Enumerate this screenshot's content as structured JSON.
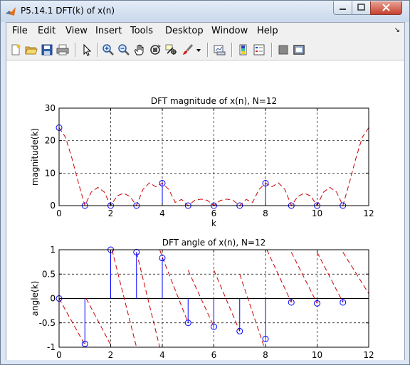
{
  "window": {
    "title": "P5.14.1 DFT(k) of x(n)"
  },
  "menubar": {
    "items": [
      "File",
      "Edit",
      "View",
      "Insert",
      "Tools",
      "Desktop",
      "Window",
      "Help"
    ]
  },
  "toolbar": {
    "icons": [
      "new-figure-icon",
      "open-file-icon",
      "save-icon",
      "print-icon",
      "edit-plot-arrow-icon",
      "zoom-in-icon",
      "zoom-out-icon",
      "pan-hand-icon",
      "rotate-3d-icon",
      "data-cursor-icon",
      "brush-icon",
      "brush-dropdown-icon",
      "link-plot-icon",
      "colorbar-icon",
      "legend-icon",
      "hide-plot-tools-icon",
      "show-plot-tools-icon"
    ]
  },
  "chart_data": [
    {
      "type": "stem",
      "title": "DFT magnitude of x(n), N=12",
      "xlabel": "k",
      "ylabel": "magnitude(k)",
      "xlim": [
        0,
        12
      ],
      "ylim": [
        0,
        30
      ],
      "xticks": [
        "0",
        "2",
        "4",
        "6",
        "8",
        "10",
        "12"
      ],
      "yticks": [
        "0",
        "10",
        "20",
        "30"
      ],
      "grid": true,
      "stem_x": [
        0,
        1,
        2,
        3,
        4,
        5,
        6,
        7,
        8,
        9,
        10,
        11
      ],
      "stem_y": [
        24,
        0,
        0,
        0,
        6.9,
        0,
        0,
        0,
        6.9,
        0,
        0,
        0
      ],
      "dashed_curve": {
        "color": "#cc0000",
        "x": [
          0,
          0.25,
          0.5,
          0.75,
          1,
          1.25,
          1.5,
          1.75,
          2,
          2.25,
          2.5,
          2.75,
          3,
          3.25,
          3.5,
          3.75,
          4,
          4.25,
          4.5,
          4.75,
          5,
          5.25,
          5.5,
          5.75,
          6,
          6.25,
          6.5,
          6.75,
          7,
          7.25,
          7.5,
          7.75,
          8,
          8.25,
          8.5,
          8.75,
          9,
          9.25,
          9.5,
          9.75,
          10,
          10.25,
          10.5,
          10.75,
          11,
          11.25,
          11.5,
          11.75,
          12
        ],
        "y": [
          24,
          21,
          14.5,
          7,
          0,
          4.2,
          5.6,
          4.2,
          0,
          3,
          3.8,
          2.8,
          0,
          5,
          7,
          5.8,
          6.9,
          5,
          1,
          1.9,
          0,
          1.6,
          2,
          1.6,
          0,
          1.6,
          2,
          1.6,
          0,
          1.9,
          1,
          5,
          6.9,
          5.8,
          7,
          5,
          0,
          2.8,
          3.8,
          3,
          0,
          4.2,
          5.6,
          4.2,
          0,
          7,
          14.5,
          21,
          24
        ]
      }
    },
    {
      "type": "stem",
      "title": "DFT angle of x(n), N=12",
      "xlabel": "k",
      "ylabel": "angle(k)",
      "xlim": [
        0,
        12
      ],
      "ylim": [
        -1,
        1
      ],
      "xticks": [
        "0",
        "2",
        "4",
        "6",
        "8",
        "10",
        "12"
      ],
      "yticks": [
        "-1",
        "-0.5",
        "0",
        "0.5",
        "1"
      ],
      "grid": true,
      "stem_x": [
        0,
        1,
        2,
        3,
        4,
        5,
        6,
        7,
        8,
        9,
        10,
        11
      ],
      "stem_y": [
        0,
        -0.93,
        1.0,
        0.95,
        0.83,
        -0.5,
        -0.58,
        -0.67,
        -0.83,
        -0.08,
        -0.1,
        -0.08
      ],
      "dashed_curve": {
        "color": "#cc0000",
        "segments": [
          {
            "x": [
              0,
              1.05
            ],
            "y": [
              0,
              -1
            ]
          },
          {
            "x": [
              1.05,
              2.05
            ],
            "y": [
              0,
              -1
            ]
          },
          {
            "x": [
              2.05,
              3.0
            ],
            "y": [
              1.0,
              -1
            ]
          },
          {
            "x": [
              3.0,
              3.9
            ],
            "y": [
              0.95,
              -1
            ]
          },
          {
            "x": [
              3.9,
              4.0
            ],
            "y": [
              1.0,
              0.85
            ]
          },
          {
            "x": [
              4.0,
              5.0
            ],
            "y": [
              0.85,
              -0.5
            ]
          },
          {
            "x": [
              5.0,
              6.0
            ],
            "y": [
              0.58,
              -0.58
            ]
          },
          {
            "x": [
              6.0,
              7.0
            ],
            "y": [
              0.58,
              -0.67
            ]
          },
          {
            "x": [
              7.0,
              7.95
            ],
            "y": [
              0.5,
              -1
            ]
          },
          {
            "x": [
              8.05,
              9.0
            ],
            "y": [
              1.0,
              -0.08
            ]
          },
          {
            "x": [
              9.0,
              10.0
            ],
            "y": [
              0.95,
              -0.1
            ]
          },
          {
            "x": [
              10.0,
              11.0
            ],
            "y": [
              0.95,
              -0.08
            ]
          },
          {
            "x": [
              11.0,
              12.0
            ],
            "y": [
              0.95,
              0.1
            ]
          }
        ]
      }
    }
  ]
}
